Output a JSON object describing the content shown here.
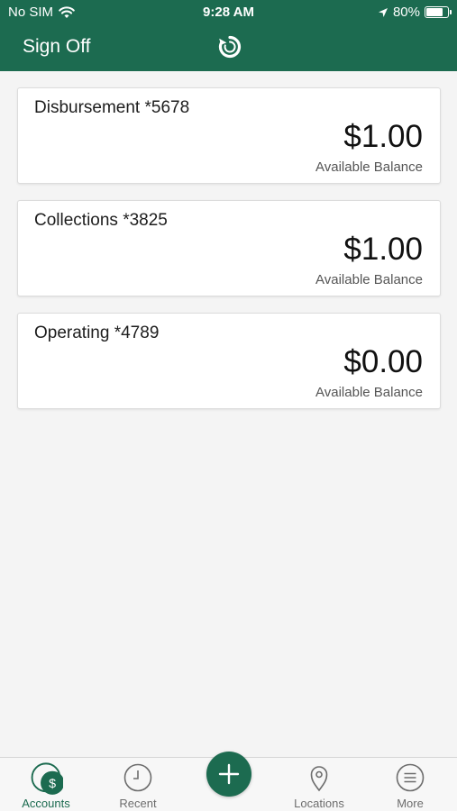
{
  "status_bar": {
    "carrier": "No SIM",
    "time": "9:28 AM",
    "battery": "80%",
    "battery_level": 0.8
  },
  "header": {
    "sign_off_label": "Sign Off"
  },
  "accounts": [
    {
      "name": "Disbursement *5678",
      "balance": "$1.00",
      "balance_label": "Available Balance"
    },
    {
      "name": "Collections *3825",
      "balance": "$1.00",
      "balance_label": "Available Balance"
    },
    {
      "name": "Operating *4789",
      "balance": "$0.00",
      "balance_label": "Available Balance"
    }
  ],
  "tabbar": {
    "accounts_label": "Accounts",
    "recent_label": "Recent",
    "locations_label": "Locations",
    "more_label": "More"
  },
  "colors": {
    "brand": "#1c6b50"
  }
}
